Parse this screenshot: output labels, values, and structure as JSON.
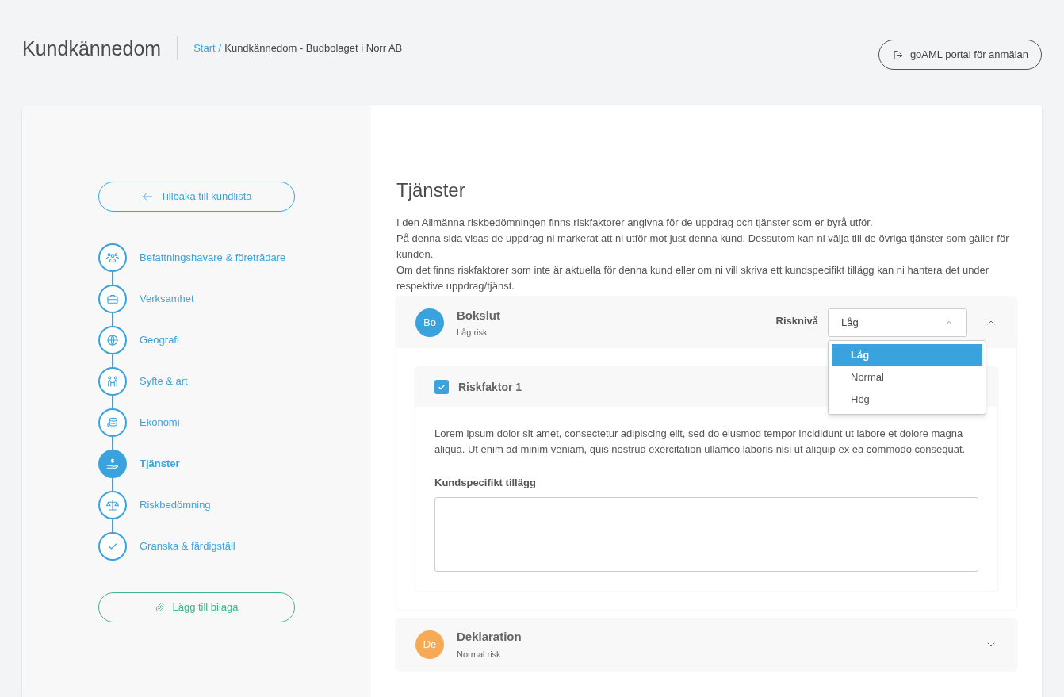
{
  "header": {
    "title": "Kundkännedom",
    "breadcrumb": [
      {
        "label": "Start",
        "kind": "link"
      },
      {
        "label": "/",
        "kind": "separator"
      },
      {
        "label": "Kundkännedom - Budbolaget i Norr AB",
        "kind": "current"
      }
    ],
    "portal_button": "goAML portal för anmälan"
  },
  "sidebar": {
    "back_button": "Tillbaka till kundlista",
    "steps": [
      {
        "label": "Befattningshavare & företrädare",
        "kind": "people",
        "selected": false
      },
      {
        "label": "Verksamhet",
        "kind": "briefcase",
        "selected": false
      },
      {
        "label": "Geografi",
        "kind": "globe",
        "selected": false
      },
      {
        "label": "Syfte & art",
        "kind": "persons",
        "selected": false
      },
      {
        "label": "Ekonomi",
        "kind": "coins",
        "selected": false
      },
      {
        "label": "Tjänster",
        "kind": "money",
        "selected": true
      },
      {
        "label": "Riskbedömning",
        "kind": "scale",
        "selected": false
      },
      {
        "label": "Granska & färdigställ",
        "kind": "check",
        "selected": false
      }
    ],
    "attach_button": "Lägg till bilaga"
  },
  "main": {
    "title": "Tjänster",
    "paragraphs": [
      "I den Allmänna riskbedömningen finns riskfaktorer angivna för de uppdrag och tjänster som er byrå utför.",
      "På denna sida visas de uppdrag ni markerat att ni utför mot just denna kund. Dessutom kan ni välja till de övriga tjänster som gäller för kunden.",
      "Om det finns riskfaktorer som inte är aktuella för denna kund eller om ni vill skriva ett kundspecifikt tillägg kan ni hantera det under respektive uppdrag/tjänst."
    ],
    "services": [
      {
        "initials": "Bo",
        "color": "#3aa3de",
        "name": "Bokslut",
        "risk": "Låg risk",
        "expanded": true,
        "risk_label": "Risknivå",
        "risk_value": "Låg",
        "dropdown_open": true,
        "options": [
          {
            "label": "Låg",
            "selected": true
          },
          {
            "label": "Normal",
            "selected": false
          },
          {
            "label": "Hög",
            "selected": false
          }
        ],
        "risk_factors": [
          {
            "title": "Riskfaktor 1",
            "checked": true,
            "text": "Lorem ipsum dolor sit amet, consectetur adipiscing elit, sed do eiusmod tempor incididunt ut labore et dolore magna aliqua. Ut enim ad minim veniam, quis nostrud exercitation ullamco laboris nisi ut aliquip ex ea commodo consequat.",
            "addition_label": "Kundspecifikt tillägg"
          }
        ]
      },
      {
        "initials": "De",
        "color": "#f7a956",
        "name": "Deklaration",
        "risk": "Normal risk",
        "expanded": false
      }
    ]
  }
}
